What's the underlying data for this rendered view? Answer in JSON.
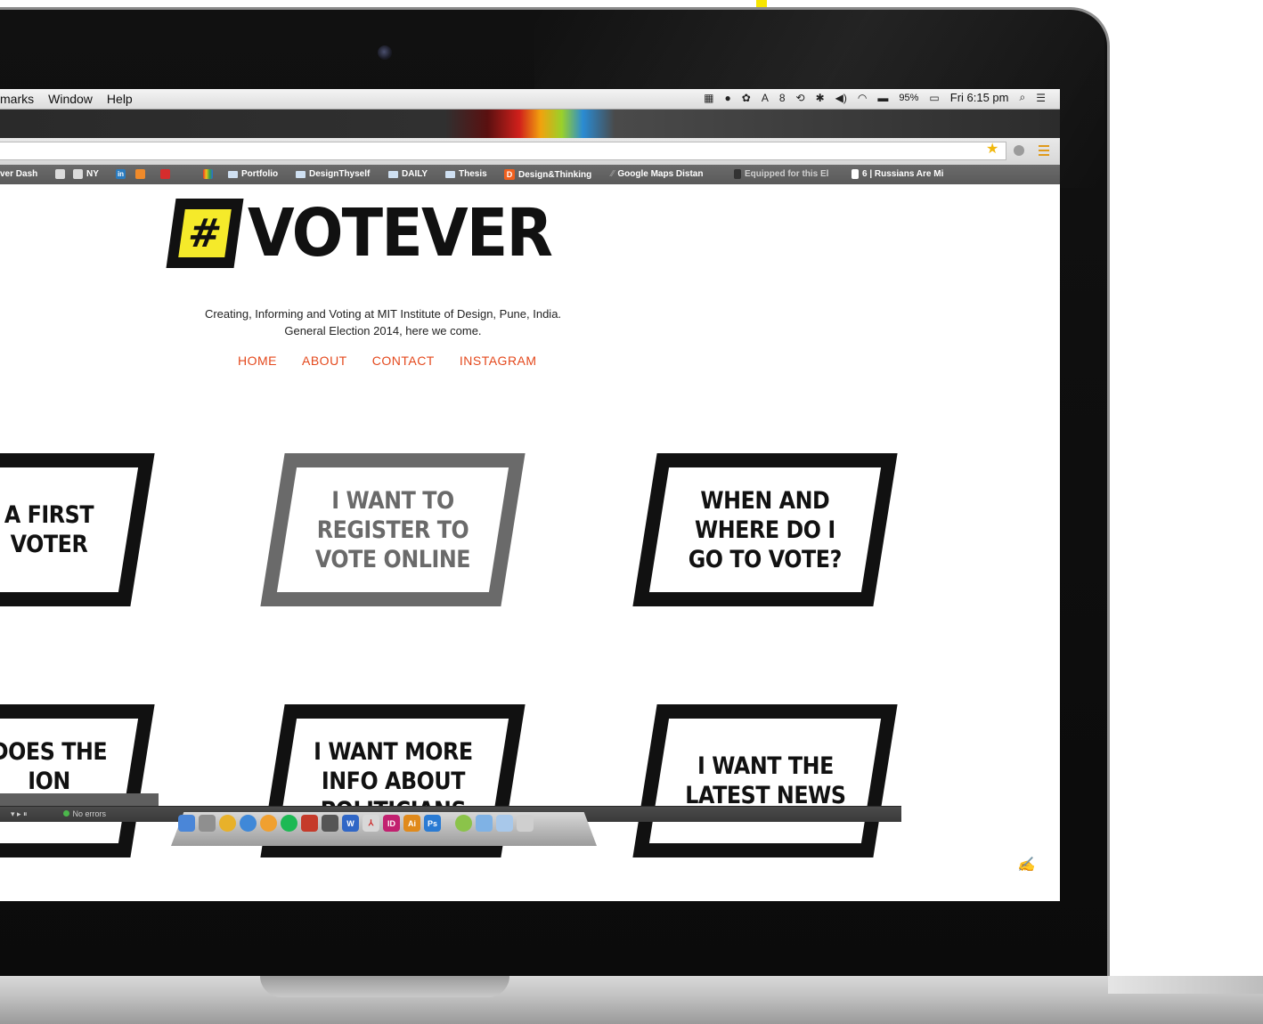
{
  "menubar": {
    "menus": [
      "marks",
      "Window",
      "Help"
    ],
    "status_misc": "8",
    "battery": "95%",
    "clock": "Fri 6:15 pm"
  },
  "bookmarks": {
    "b0": "ver Dash",
    "b1": "NY",
    "b2": "Portfolio",
    "b3": "DesignThyself",
    "b4": "DAILY",
    "b5": "Thesis",
    "b6": "Design&Thinking",
    "b7": "Google Maps Distan",
    "b8": "Equipped for this El",
    "b9": "6 | Russians Are Mi"
  },
  "site": {
    "logo_mark": "#",
    "logo_word": "VOTEVER",
    "tagline_1": "Creating, Informing and Voting at MIT Institute of Design, Pune, India.",
    "tagline_2": "General Election 2014, here we come.",
    "nav": [
      "HOME",
      "ABOUT",
      "CONTACT",
      "INSTAGRAM"
    ]
  },
  "cards": [
    {
      "text": "A FIRST\nVOTER"
    },
    {
      "text": "I WANT TO\nREGISTER TO\nVOTE ONLINE"
    },
    {
      "text": "WHEN AND\nWHERE DO I\nGO TO VOTE?"
    },
    {
      "text": "DOES THE\nION\nM WORK?"
    },
    {
      "text": "I WANT MORE\nINFO ABOUT\nPOLITICIANS"
    },
    {
      "text": "I WANT THE\nLATEST NEWS"
    }
  ],
  "devbar": {
    "status": "No errors"
  },
  "colors": {
    "accent": "#e4481c",
    "logo_yellow": "#f5ea2a",
    "frame_black": "#111111",
    "frame_grey": "#6a6a6a"
  }
}
